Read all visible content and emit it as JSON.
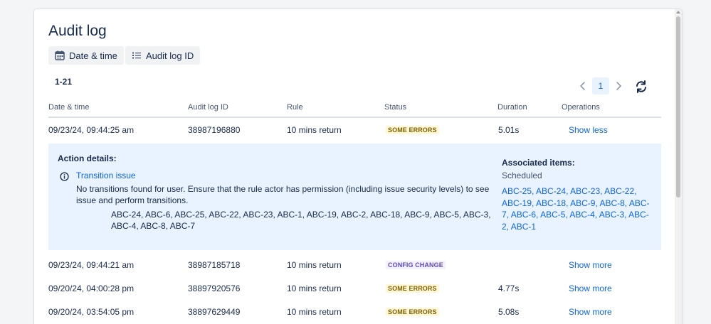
{
  "title": "Audit log",
  "filters": [
    {
      "label": "Date & time",
      "icon": "calendar-icon"
    },
    {
      "label": "Audit log ID",
      "icon": "list-icon"
    }
  ],
  "range_text": "1-21",
  "pagination": {
    "current_page": "1"
  },
  "columns": [
    "Date & time",
    "Audit log ID",
    "Rule",
    "Status",
    "Duration",
    "Operations"
  ],
  "rows": [
    {
      "datetime": "09/23/24, 09:44:25 am",
      "id": "38987196880",
      "rule": "10 mins return",
      "status": "SOME ERRORS",
      "status_kind": "errors",
      "duration": "5.01s",
      "operation": "Show less"
    },
    {
      "datetime": "09/23/24, 09:44:21 am",
      "id": "38987185718",
      "rule": "10 mins return",
      "status": "CONFIG CHANGE",
      "status_kind": "config",
      "duration": "",
      "operation": "Show more"
    },
    {
      "datetime": "09/20/24, 04:00:28 pm",
      "id": "38897920576",
      "rule": "10 mins return",
      "status": "SOME ERRORS",
      "status_kind": "errors",
      "duration": "4.77s",
      "operation": "Show more"
    },
    {
      "datetime": "09/20/24, 03:54:05 pm",
      "id": "38897629449",
      "rule": "10 mins return",
      "status": "SOME ERRORS",
      "status_kind": "errors",
      "duration": "5.08s",
      "operation": "Show more"
    }
  ],
  "details": {
    "title": "Action details:",
    "issue_title": "Transition issue",
    "message": "No transitions found for user. Ensure that the rule actor has permission (including issue security levels) to see issue and perform transitions.",
    "issue_keys": "ABC-24, ABC-6, ABC-25, ABC-22, ABC-23, ABC-1, ABC-19, ABC-2, ABC-18, ABC-9, ABC-5, ABC-3, ABC-4, ABC-8, ABC-7",
    "associated_title": "Associated items:",
    "associated_status": "Scheduled",
    "associated_items": [
      "ABC-25",
      "ABC-24",
      "ABC-23",
      "ABC-22",
      "ABC-19",
      "ABC-18",
      "ABC-9",
      "ABC-8",
      "ABC-7",
      "ABC-6",
      "ABC-5",
      "ABC-4",
      "ABC-3",
      "ABC-2",
      "ABC-1"
    ]
  },
  "colors": {
    "link": "#0c66e4",
    "details_bg": "#e9f2ff",
    "errors_bg": "#fff7d6",
    "config_bg": "#f3f0ff"
  }
}
